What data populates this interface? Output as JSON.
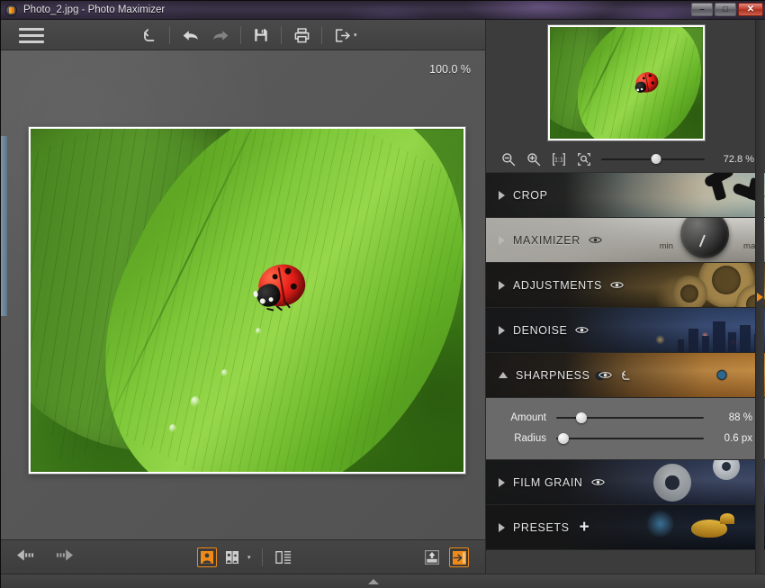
{
  "window": {
    "title": "Photo_2.jpg - Photo Maximizer",
    "app_icon": "photo-maximizer-icon",
    "controls": {
      "minimize": "–",
      "maximize": "□",
      "close": "✕"
    }
  },
  "toolbar": {
    "menu_icon": "hamburger-menu-icon",
    "items": [
      {
        "name": "revert-button",
        "icon": "revert-arrow-icon",
        "enabled": true
      },
      {
        "name": "undo-button",
        "icon": "undo-arrow-icon",
        "enabled": true
      },
      {
        "name": "redo-button",
        "icon": "redo-arrow-icon",
        "enabled": false
      },
      {
        "name": "save-button",
        "icon": "floppy-disk-icon",
        "enabled": true
      },
      {
        "name": "print-button",
        "icon": "printer-icon",
        "enabled": true
      },
      {
        "name": "export-button",
        "icon": "share-export-icon",
        "enabled": true
      }
    ],
    "export_caret": "▾"
  },
  "canvas": {
    "zoom_label": "100.0 %",
    "image_alt": "ladybug-on-green-leaf"
  },
  "bottom_toolbar": {
    "prev_label": "previous-image",
    "next_label": "next-image",
    "view_single": "single-view",
    "view_compare": "compare-view",
    "compare_caret": "▾",
    "view_before_after": "before-after-view",
    "upload": "upload-image",
    "export_next": "export-image"
  },
  "statusbar": {
    "expand_icon": "expand-filmstrip-icon"
  },
  "navigator": {
    "thumbnail_alt": "navigator-thumbnail-ladybug",
    "zoom_out_icon": "zoom-out-icon",
    "zoom_in_icon": "zoom-in-icon",
    "actual_size_icon": "actual-size-1-1-icon",
    "fit_icon": "fit-to-window-icon",
    "zoom_value": "72.8 %",
    "zoom_slider_percent": 53
  },
  "panel": {
    "collapse_handle_icon": "panel-collapse-arrow-icon",
    "sections": [
      {
        "id": "crop",
        "label": "CROP",
        "expanded": false,
        "has_eye": false,
        "has_reset": false,
        "has_plus": false,
        "style": "dark"
      },
      {
        "id": "maximizer",
        "label": "MAXIMIZER",
        "expanded": false,
        "has_eye": true,
        "has_reset": false,
        "has_plus": false,
        "style": "light",
        "knob_min_label": "min",
        "knob_max_label": "max"
      },
      {
        "id": "adjustments",
        "label": "ADJUSTMENTS",
        "expanded": false,
        "has_eye": true,
        "has_reset": false,
        "has_plus": false,
        "style": "dark"
      },
      {
        "id": "denoise",
        "label": "DENOISE",
        "expanded": false,
        "has_eye": true,
        "has_reset": false,
        "has_plus": false,
        "style": "dark"
      },
      {
        "id": "sharpness",
        "label": "SHARPNESS",
        "expanded": true,
        "has_eye": true,
        "has_reset": true,
        "has_plus": false,
        "style": "dark"
      },
      {
        "id": "filmgrain",
        "label": "FILM GRAIN",
        "expanded": false,
        "has_eye": true,
        "has_reset": false,
        "has_plus": false,
        "style": "dark"
      },
      {
        "id": "presets",
        "label": "PRESETS",
        "expanded": false,
        "has_eye": false,
        "has_reset": false,
        "has_plus": true,
        "style": "dark"
      }
    ],
    "sharpness_controls": [
      {
        "label": "Amount",
        "value": "88 %",
        "percent": 17
      },
      {
        "label": "Radius",
        "value": "0.6 px",
        "percent": 5
      }
    ]
  },
  "colors": {
    "accent": "#ef8a18",
    "panel_bg": "#3c3c3c",
    "toolbar_bg": "#454545",
    "canvas_bg": "#5a5a5a",
    "slider_bg": "#6a6a6a",
    "close_red": "#c23c2c"
  }
}
